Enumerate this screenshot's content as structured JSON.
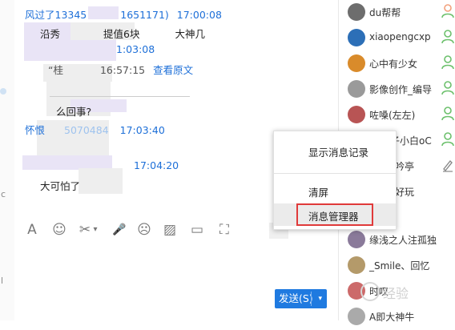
{
  "chat": {
    "messages": [
      {
        "sender_fragment": "风过了13345",
        "sender_tail": "1651171)",
        "time": "17:00:08"
      },
      {
        "body_fragment_1": "沿秀",
        "body_fragment_2": "提值6块",
        "body_fragment_3": "大神几"
      },
      {
        "time_fragment": "1:03:08"
      },
      {
        "quote_mark": "“桂",
        "quote_time": "16:57:15",
        "view_original": "查看原文"
      },
      {
        "body_tail": "么回事?"
      },
      {
        "sender_fragment": "怀恨",
        "sender_mid": "5070484",
        "time": "17:03:40"
      },
      {
        "time": "17:04:20"
      },
      {
        "body_fragment": "大可怕了"
      }
    ]
  },
  "toolbar": {
    "icons": [
      "font-icon",
      "emoji-icon",
      "scissors-icon",
      "mic-icon",
      "mask-icon",
      "image-icon",
      "folder-icon",
      "gift-icon"
    ],
    "glyphs": [
      "A",
      "☺",
      "✂",
      "🎤",
      "☹",
      "▨",
      "▭",
      "⛶"
    ],
    "scissors_arrow": "▾"
  },
  "send": {
    "label": "发送(S)",
    "arrow": "▾"
  },
  "context_menu": {
    "items": [
      "显示消息记录",
      "清屏",
      "消息管理器"
    ],
    "highlighted_index": 2
  },
  "members": [
    {
      "name": "du帮帮",
      "avatar_color": "#6d6d6d",
      "role_color": "#f2a07c"
    },
    {
      "name": "xiaopengcxp",
      "avatar_color": "#2c6fb7",
      "role_color": "#6cc06c"
    },
    {
      "name": "心中有少女",
      "avatar_color": "#d98b2b",
      "role_color": "#6cc06c"
    },
    {
      "name": "影像创作_编导",
      "avatar_color": "#9a9a9a",
      "role_color": "#6cc06c"
    },
    {
      "name": "咗嗓(左左)",
      "avatar_color": "#b85454",
      "role_color": "#6cc06c"
    },
    {
      "name": "子小白oC",
      "avatar_color": "#c44a2a",
      "role_color": "#6cc06c"
    },
    {
      "name": "吟亭",
      "avatar_color": "#7a7a7a",
      "role_color": "#888888"
    },
    {
      "name": "好玩",
      "avatar_color": "#4a8a4a",
      "role_color": ""
    },
    {
      "name": "缘浅之人注孤独",
      "avatar_color": "#8a7a9a",
      "role_color": ""
    },
    {
      "name": "_Smile、回忆",
      "avatar_color": "#b49a6a",
      "role_color": ""
    },
    {
      "name": "时叹",
      "avatar_color": "#cc6a6a",
      "role_color": ""
    },
    {
      "name": "A即大神牛",
      "avatar_color": "#aaaaaa",
      "role_color": ""
    }
  ],
  "watermark": {
    "text": "经验"
  }
}
